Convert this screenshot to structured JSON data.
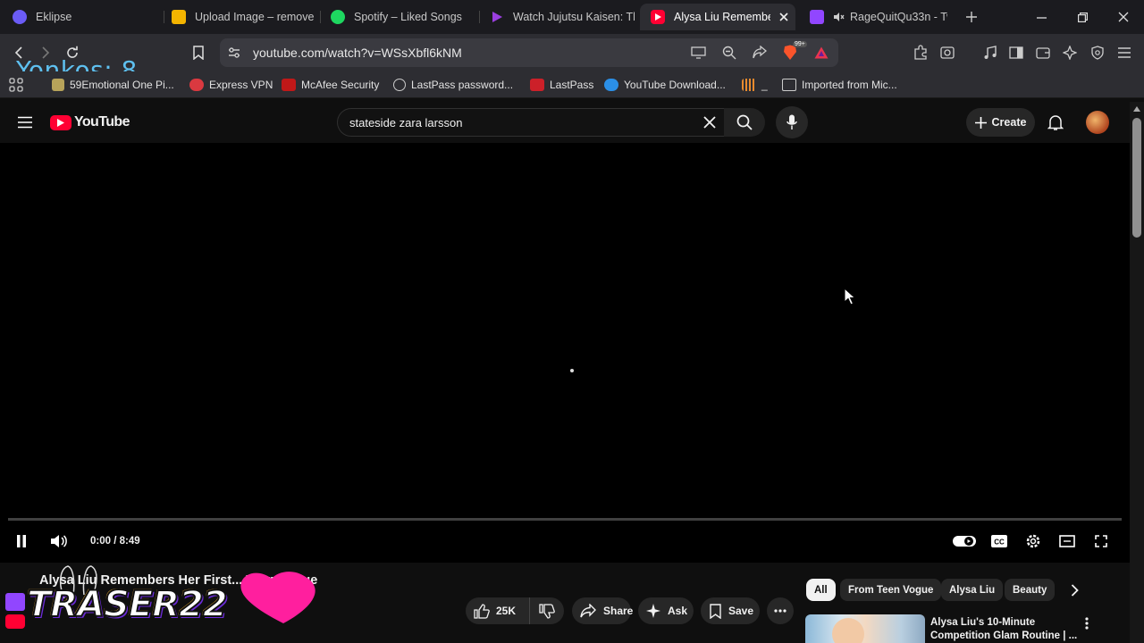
{
  "browser": {
    "tabs": [
      {
        "label": "Eklipse",
        "icon": "eklipse-icon"
      },
      {
        "label": "Upload Image – remove",
        "icon": "slides-icon"
      },
      {
        "label": "Spotify – Liked Songs",
        "icon": "spotify-icon"
      },
      {
        "label": "Watch Jujutsu Kaisen: Th",
        "icon": "play-icon"
      },
      {
        "label": "Alysa Liu Remembe",
        "icon": "youtube-icon",
        "active": true
      },
      {
        "label": "RageQuitQu33n - Tw",
        "icon": "twitch-icon"
      }
    ],
    "url": "youtube.com/watch?v=WSsXbfl6kNM",
    "shields_badge": "99+",
    "overlay_text": "Yonkos: 8",
    "bookmarks": [
      "59Emotional One Pi...",
      "Express VPN",
      "McAfee Security",
      "LastPass password...",
      "LastPass",
      "YouTube Download...",
      "_",
      "Imported from Mic..."
    ]
  },
  "youtube": {
    "logo_text": "YouTube",
    "search_value": "stateside zara larsson",
    "create_label": "Create",
    "player": {
      "time": "0:00 / 8:49",
      "progress": 0
    },
    "video_title": "Alysa Liu Remembers Her First... Teen Vogue",
    "actions": {
      "likes": "25K",
      "share": "Share",
      "ask": "Ask",
      "save": "Save"
    },
    "chips": [
      "All",
      "From Teen Vogue",
      "Alysa Liu",
      "Beauty"
    ],
    "recommendation": {
      "title_line1": "Alysa Liu's 10-Minute",
      "title_line2": "Competition Glam Routine | ..."
    },
    "watermark_text": "TRASER22"
  },
  "colors": {
    "youtube_red": "#ff0033",
    "overlay_blue": "#5ec0f0",
    "background": "#0f0f0f"
  }
}
